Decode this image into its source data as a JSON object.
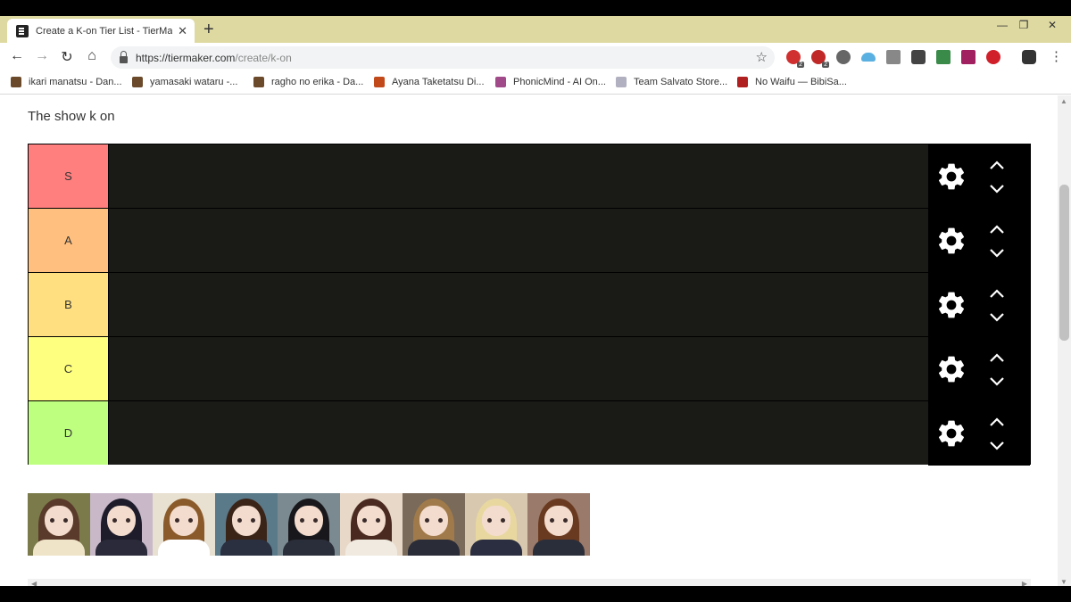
{
  "browser": {
    "tab_title": "Create a K-on Tier List - TierMaker",
    "tab_close": "✕",
    "new_tab": "+",
    "url_scheme": "https://tiermaker.com",
    "url_path": "/create/k-on",
    "controls": {
      "back": "←",
      "forward": "→",
      "reload": "↻",
      "home": "⌂",
      "star": "☆",
      "menu": "⋮",
      "minimize": "—",
      "maximize": "❐",
      "close": "✕"
    },
    "extension_badges": [
      "2",
      "2"
    ],
    "bookmarks": [
      {
        "label": "ikari manatsu - Dan...",
        "color": "#6b4a2b"
      },
      {
        "label": "yamasaki wataru -...",
        "color": "#6b4a2b"
      },
      {
        "label": "ragho no erika - Da...",
        "color": "#6b4a2b"
      },
      {
        "label": "Ayana Taketatsu Di...",
        "color": "#c24a1a"
      },
      {
        "label": "PhonicMind - AI On...",
        "color": "#a04a8a"
      },
      {
        "label": "Team Salvato Store...",
        "color": "#b0b0c0"
      },
      {
        "label": "No Waifu — BibiSa...",
        "color": "#b02020"
      }
    ]
  },
  "page": {
    "title": "The show k on",
    "tiers": [
      {
        "label": "S",
        "color": "#ff7f7f"
      },
      {
        "label": "A",
        "color": "#ffbf7f"
      },
      {
        "label": "B",
        "color": "#ffdf7f"
      },
      {
        "label": "C",
        "color": "#ffff7f"
      },
      {
        "label": "D",
        "color": "#bfff7f"
      }
    ],
    "items": [
      {
        "hair": "#5a3a2a",
        "bg": "#7a7a4a",
        "body": "#f0e4c8"
      },
      {
        "hair": "#1e1c2a",
        "bg": "#c8b8c8",
        "body": "#2a2a3a"
      },
      {
        "hair": "#8a5a2a",
        "bg": "#e8e0d0",
        "body": "#ffffff"
      },
      {
        "hair": "#3a2418",
        "bg": "#5a7a8a",
        "body": "#2a3040"
      },
      {
        "hair": "#18181c",
        "bg": "#7a8a90",
        "body": "#2a2e3a"
      },
      {
        "hair": "#4a2a20",
        "bg": "#e8d8c8",
        "body": "#f0eae0"
      },
      {
        "hair": "#a07a4a",
        "bg": "#7a6a5a",
        "body": "#2a2c38"
      },
      {
        "hair": "#e8d8a0",
        "bg": "#d8c8b0",
        "body": "#2a2e40"
      },
      {
        "hair": "#6a3a20",
        "bg": "#9a7a6a",
        "body": "#2a2e3a"
      }
    ]
  }
}
